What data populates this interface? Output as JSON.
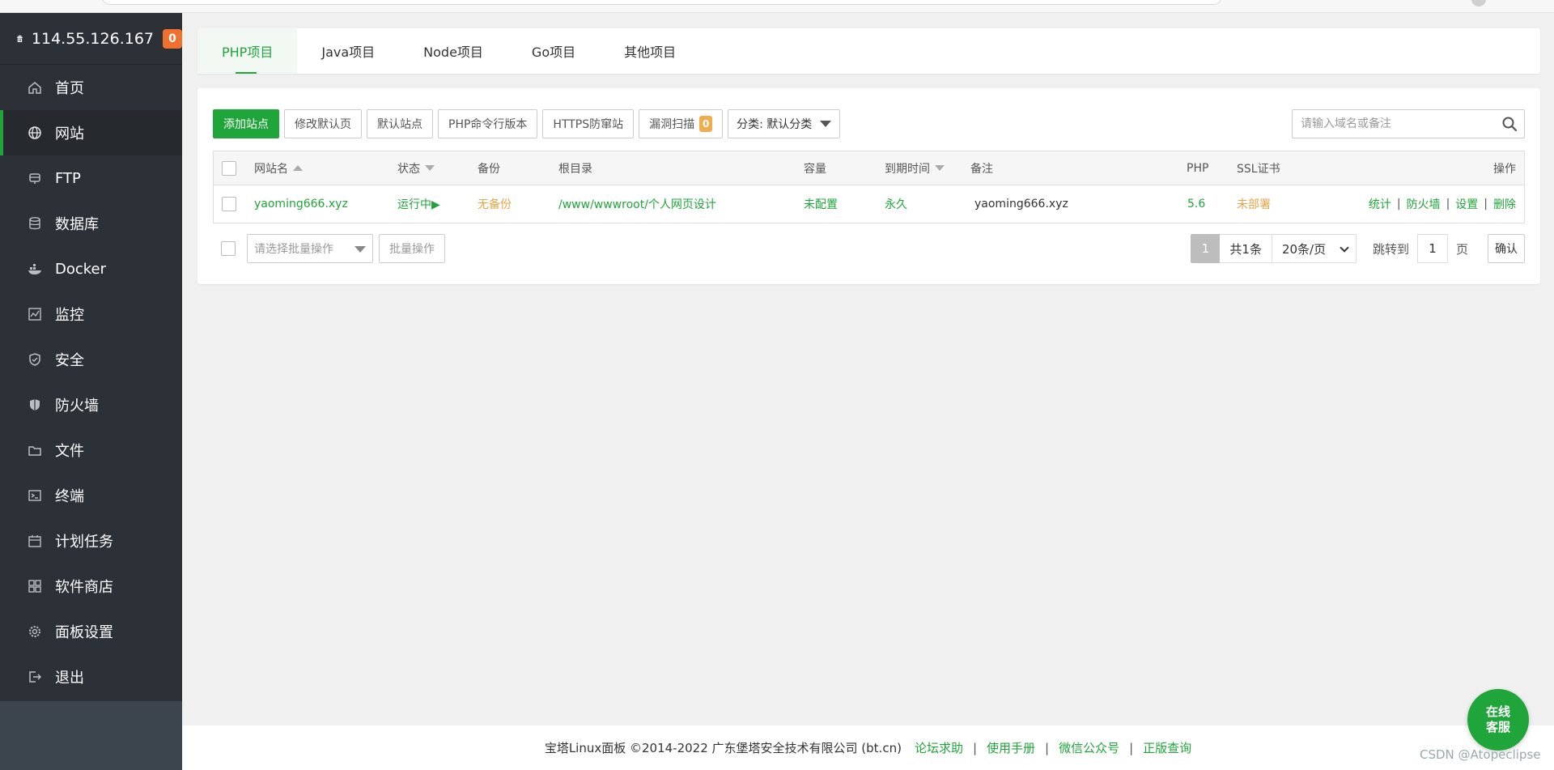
{
  "brand": {
    "ip": "114.55.126.167",
    "badge": "0"
  },
  "sidebar": {
    "items": [
      {
        "label": "首页",
        "icon": "home-icon",
        "active": false
      },
      {
        "label": "网站",
        "icon": "globe-icon",
        "active": true
      },
      {
        "label": "FTP",
        "icon": "ftp-icon",
        "active": false
      },
      {
        "label": "数据库",
        "icon": "database-icon",
        "active": false
      },
      {
        "label": "Docker",
        "icon": "docker-icon",
        "active": false
      },
      {
        "label": "监控",
        "icon": "monitor-icon",
        "active": false
      },
      {
        "label": "安全",
        "icon": "shield-check-icon",
        "active": false
      },
      {
        "label": "防火墙",
        "icon": "firewall-shield-icon",
        "active": false
      },
      {
        "label": "文件",
        "icon": "folder-icon",
        "active": false
      },
      {
        "label": "终端",
        "icon": "terminal-icon",
        "active": false
      },
      {
        "label": "计划任务",
        "icon": "calendar-icon",
        "active": false
      },
      {
        "label": "软件商店",
        "icon": "apps-grid-icon",
        "active": false
      },
      {
        "label": "面板设置",
        "icon": "gear-icon",
        "active": false
      },
      {
        "label": "退出",
        "icon": "logout-icon",
        "active": false
      }
    ]
  },
  "tabs": [
    {
      "label": "PHP项目",
      "active": true
    },
    {
      "label": "Java项目",
      "active": false
    },
    {
      "label": "Node项目",
      "active": false
    },
    {
      "label": "Go项目",
      "active": false
    },
    {
      "label": "其他项目",
      "active": false
    }
  ],
  "toolbar": {
    "add_site": "添加站点",
    "modify_default_page": "修改默认页",
    "default_site": "默认站点",
    "php_cli_version": "PHP命令行版本",
    "https_protect": "HTTPS防窜站",
    "vuln_scan": "漏洞扫描",
    "vuln_scan_badge": "0",
    "category": "分类: 默认分类"
  },
  "search": {
    "placeholder": "请输入域名或备注",
    "value": ""
  },
  "table": {
    "headers": {
      "site_name": "网站名",
      "status": "状态",
      "backup": "备份",
      "root_dir": "根目录",
      "capacity": "容量",
      "expire": "到期时间",
      "remark": "备注",
      "php": "PHP",
      "ssl": "SSL证书",
      "actions": "操作"
    },
    "rows": [
      {
        "site_name": "yaoming666.xyz",
        "status": "运行中▶",
        "backup": "无备份",
        "root_dir": "/www/wwwroot/个人网页设计",
        "capacity": "未配置",
        "expire": "永久",
        "remark": "yaoming666.xyz",
        "php": "5.6",
        "ssl": "未部署",
        "actions": [
          "统计",
          "防火墙",
          "设置",
          "删除"
        ],
        "separator": "|"
      }
    ]
  },
  "batch": {
    "placeholder": "请选择批量操作",
    "button": "批量操作"
  },
  "pager": {
    "current": "1",
    "total": "共1条",
    "page_size": "20条/页",
    "jump_label": "跳转到",
    "jump_value": "1",
    "page_unit": "页",
    "confirm": "确认"
  },
  "footer": {
    "copyright": "宝塔Linux面板 ©2014-2022 广东堡塔安全技术有限公司 (bt.cn)",
    "links": [
      "论坛求助",
      "使用手册",
      "微信公众号",
      "正版查询"
    ],
    "separator": "|"
  },
  "chat": {
    "line1": "在线",
    "line2": "客服"
  },
  "watermark": "CSDN @Atopeclipse",
  "colors": {
    "accent": "#20a53a",
    "warning": "#e4a44a",
    "badge": "#f0712d",
    "sidebar": "#2c3138"
  }
}
